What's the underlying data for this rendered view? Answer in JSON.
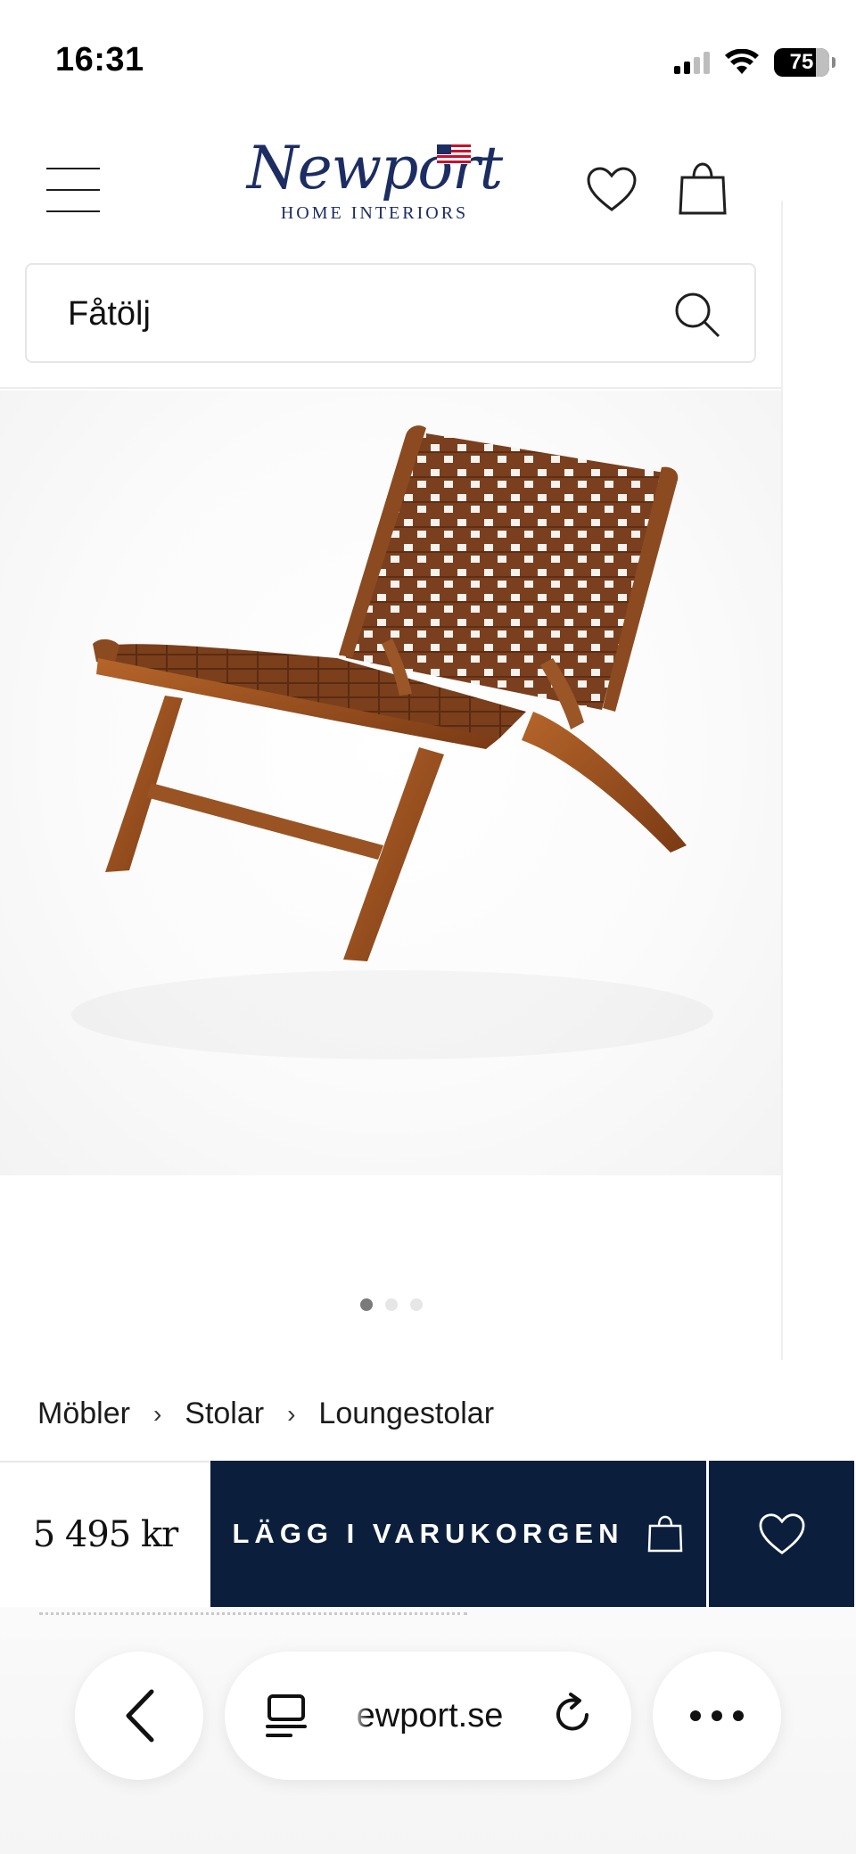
{
  "status_bar": {
    "time": "16:31",
    "battery": "75"
  },
  "header": {
    "logo_name": "Newport",
    "logo_tagline": "HOME INTERIORS",
    "icons": [
      "menu-icon",
      "heart-icon",
      "shopping-bag-icon"
    ]
  },
  "search": {
    "value": "Fåtölj",
    "icon": "search-icon"
  },
  "gallery": {
    "image_count": 3,
    "active_index": 0
  },
  "breadcrumb": {
    "items": [
      "Möbler",
      "Stolar",
      "Loungestolar"
    ],
    "separator": "›"
  },
  "buy_bar": {
    "price": "5 495 kr",
    "add_to_cart_label": "LÄGG I VARUKORGEN",
    "accent_color": "#0b1f3d"
  },
  "browser": {
    "url": "ewport.se",
    "icons": [
      "back-chevron-icon",
      "tabs-icon",
      "reload-icon",
      "more-icon"
    ]
  }
}
